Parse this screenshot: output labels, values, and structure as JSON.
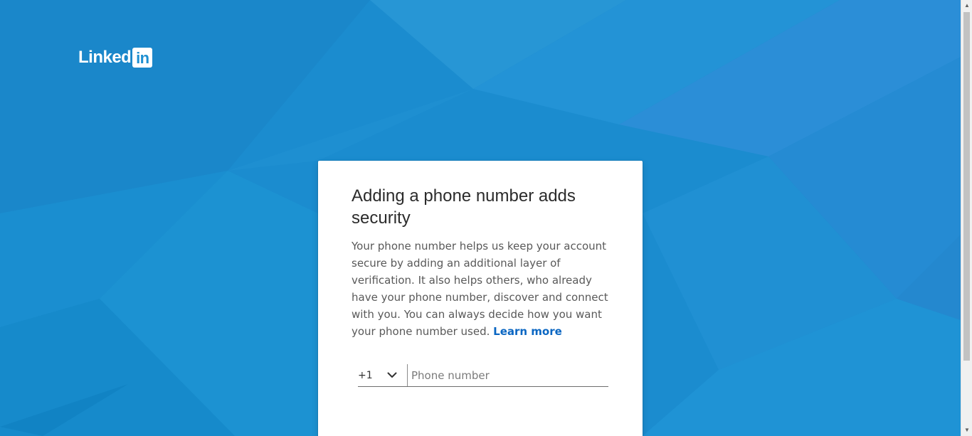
{
  "brand": {
    "logo_text": "Linked",
    "logo_box_text": "in",
    "primary_color": "#1d8fd1",
    "link_color": "#0a66c2"
  },
  "card": {
    "title": "Adding a phone number adds security",
    "body": "Your phone number helps us keep your account secure by adding an additional layer of verification. It also helps others, who already have your phone number, discover and connect with you. You can always decide how you want your phone number used.",
    "learn_more": "Learn more"
  },
  "phone": {
    "country_code": "+1",
    "country_icon": "chevron-down-icon",
    "placeholder": "Phone number",
    "value": ""
  },
  "scrollbar": {
    "up_icon": "scroll-up-arrow-icon",
    "down_icon": "scroll-down-arrow-icon"
  }
}
